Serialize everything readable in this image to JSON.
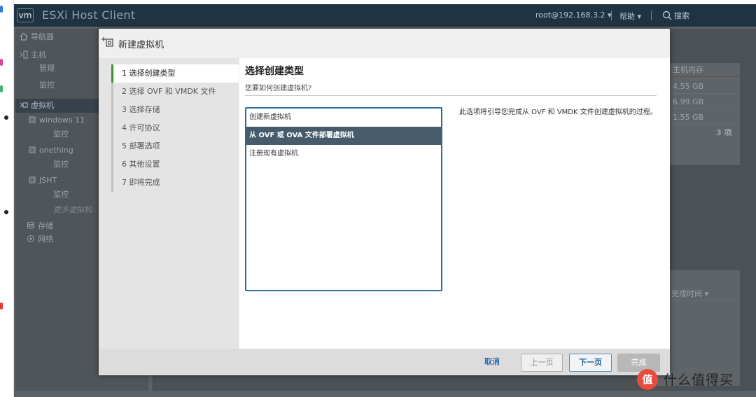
{
  "app": {
    "logo": "vm",
    "title": "ESXi Host Client",
    "user": "root@192.168.3.2 ▾",
    "help": "帮助 ▾",
    "search": "搜索"
  },
  "navigator": {
    "title": "导航器",
    "host": "主机",
    "manage": "管理",
    "monitor": "监控",
    "vms": "虚拟机",
    "vm_list": [
      {
        "name": "windows 11",
        "monitor": "监控"
      },
      {
        "name": "onething",
        "monitor": "监控"
      },
      {
        "name": "JSHT",
        "monitor": "监控"
      }
    ],
    "more_vms": "更多虚拟机...",
    "storage": "存储",
    "network": "网络"
  },
  "background": {
    "memory_header": "主机内存",
    "memory_values": [
      "4.55 GB",
      "6.99 GB",
      "1.55 GB"
    ],
    "item_count": "3 项",
    "task_header": "完成时间 ▾"
  },
  "dialog": {
    "title": "新建虚拟机",
    "steps": [
      "1  选择创建类型",
      "2  选择 OVF 和 VMDK 文件",
      "3  选择存储",
      "4  许可协议",
      "5  部署选项",
      "6  其他设置",
      "7  即将完成"
    ],
    "content_title": "选择创建类型",
    "content_subtitle": "您要如何创建虚拟机?",
    "types": [
      "创建新虚拟机",
      "从 OVF 或 OVA 文件部署虚拟机",
      "注册现有虚拟机"
    ],
    "description": "此选项将引导您完成从 OVF 和 VMDK 文件创建虚拟机的过程。",
    "buttons": {
      "cancel": "取消",
      "prev": "上一页",
      "next": "下一页",
      "finish": "完成"
    }
  },
  "watermark": {
    "logo": "值",
    "text": "什么值得买"
  },
  "colors": {
    "titlebar": "#1f3442",
    "selected_row": "#475b6a",
    "active_step": "#3f8f2f",
    "link_blue": "#2a6cb0"
  }
}
